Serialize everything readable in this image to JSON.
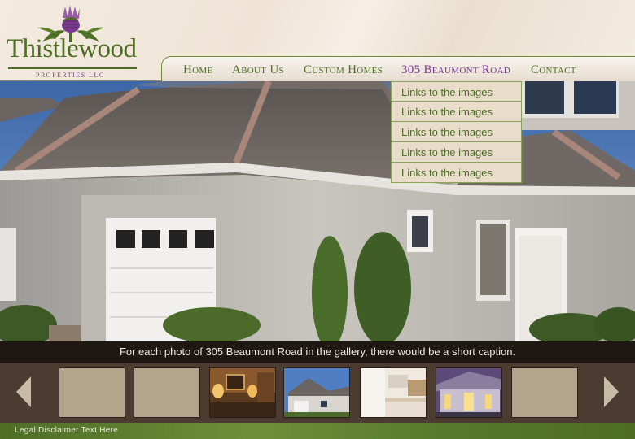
{
  "brand": {
    "name": "Thistlewood",
    "tagline": "PROPERTIES LLC",
    "colors": {
      "green": "#4d6e25",
      "purple": "#7a3a8c",
      "tan": "#e9dccb",
      "dark": "#4b3b30"
    }
  },
  "nav": {
    "items": [
      {
        "label": "Home",
        "active": false
      },
      {
        "label": "About Us",
        "active": false
      },
      {
        "label": "Custom Homes",
        "active": false
      },
      {
        "label": "305 Beaumont Road",
        "active": true
      },
      {
        "label": "Contact",
        "active": false
      }
    ]
  },
  "dropdown": {
    "items": [
      {
        "label": "Links to the images"
      },
      {
        "label": "Links to the images"
      },
      {
        "label": "Links to the images"
      },
      {
        "label": "Links to the images"
      },
      {
        "label": "Links to the images"
      }
    ]
  },
  "caption": "For each photo of 305 Beaumont Road in the gallery, there would be a short caption.",
  "gallery": {
    "prev_icon": "chevron-left-icon",
    "next_icon": "chevron-right-icon",
    "thumbnails": [
      {
        "kind": "placeholder"
      },
      {
        "kind": "placeholder"
      },
      {
        "kind": "interior-living-room"
      },
      {
        "kind": "house-exterior"
      },
      {
        "kind": "interior-kitchen"
      },
      {
        "kind": "exterior-dusk"
      },
      {
        "kind": "placeholder"
      }
    ]
  },
  "footer": {
    "text": "Legal Disclaimer Text Here"
  }
}
